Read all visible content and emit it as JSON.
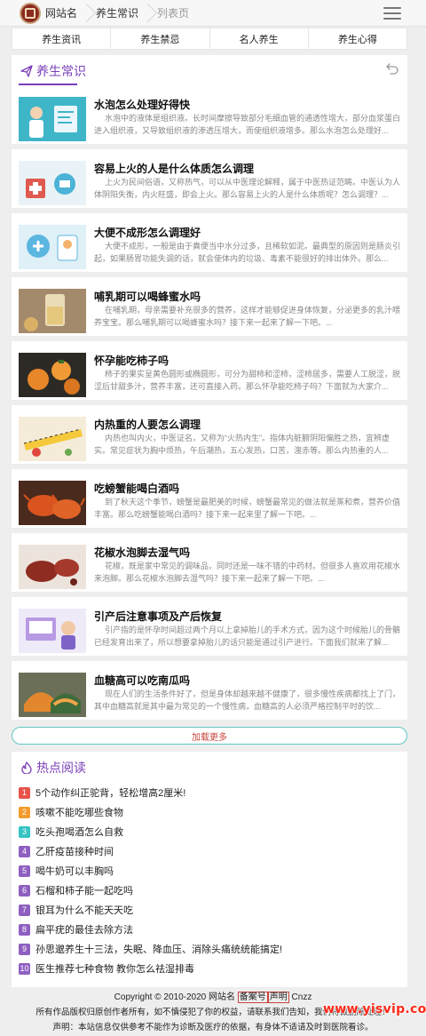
{
  "header": {
    "site_name": "网站名",
    "section": "养生常识",
    "page": "列表页"
  },
  "nav": [
    {
      "label": "养生资讯"
    },
    {
      "label": "养生禁忌"
    },
    {
      "label": "名人养生"
    },
    {
      "label": "养生心得"
    }
  ],
  "main": {
    "section_title": "养生常识",
    "articles": [
      {
        "title": "水泡怎么处理好得快",
        "desc": "水泡中的液体是组织液。长时间摩擦导致部分毛细血管的通透性增大，部分血浆蛋白进入组织液，又导致组织液的渗透压增大，而使组织液增多。那么水泡怎么处理好..."
      },
      {
        "title": "容易上火的人是什么体质怎么调理",
        "desc": "上火为民间俗语，又称热气，可以从中医理论解释，属于中医热证范畴。中医认为人体阴阳失衡，内火旺盛，即会上火。那么容易上火的人是什么体质呢？怎么调理？..."
      },
      {
        "title": "大便不成形怎么调理好",
        "desc": "大便不成形，一般是由于粪便当中水分过多，且稀软如泥。最典型的原因则是肠炎引起，如果肠胃功能失调的话，就会使体内的垃圾、毒素不能很好的排出体外。那么..."
      },
      {
        "title": "哺乳期可以喝蜂蜜水吗",
        "desc": "在哺乳期，母亲需要补充很多的营养，这样才能够促进身体恢复，分泌更多的乳汁喂养宝宝。那么哺乳期可以喝蜂蜜水吗？接下来一起来了解一下吧。..."
      },
      {
        "title": "怀孕能吃柿子吗",
        "desc": "柿子的果实呈黄色圆形或椭圆形，可分为甜柿和涩柿，涩柿居多，需要人工脱涩，脱涩后甘甜多汁，营养丰富，还可直接入药。那么怀孕能吃柿子吗？下面就为大家介..."
      },
      {
        "title": "内热重的人要怎么调理",
        "desc": "内热也叫内火，中医证名，又称为“火热内生”。指体内脏腑阴阳偏胜之热，宜辨虚实。常见症状为胸中烦热，午后潮热，五心发热，口苦，溲赤等。那么内热重的人..."
      },
      {
        "title": "吃螃蟹能喝白酒吗",
        "desc": "到了秋天这个季节，螃蟹是最肥美的时候，螃蟹最常见的做法就是蒸和煮，营养价值丰富。那么吃螃蟹能喝白酒吗？接下来一起来里了解一下吧。..."
      },
      {
        "title": "花椒水泡脚去湿气吗",
        "desc": "花椒，既是家中常见的调味品，同时还是一味不错的中药材。但很多人喜欢用花椒水来泡脚。那么花椒水泡脚去湿气吗？接下来一起来了解一下吧。..."
      },
      {
        "title": "引产后注意事项及产后恢复",
        "desc": "引产指的是怀孕时间超过两个月以上拿掉胎儿的手术方式，因为这个时候胎儿的骨骼已经发育出来了，所以想要拿掉胎儿的话只能是通过引产进行。下面我们就来了解..."
      },
      {
        "title": "血糖高可以吃南瓜吗",
        "desc": "现在人们的生活条件好了，但是身体却越来越不健康了，很多慢性疾病都找上了门，其中血糖高就是其中最为常见的一个慢性病，血糖高的人必须严格控制平时的饮..."
      }
    ],
    "load_more": "加载更多"
  },
  "hot": {
    "title": "热点阅读",
    "items": [
      {
        "num": "1",
        "label": "5个动作纠正驼背，轻松增高2厘米!",
        "color": "#e8534a"
      },
      {
        "num": "2",
        "label": "咳嗽不能吃哪些食物",
        "color": "#f39b2e"
      },
      {
        "num": "3",
        "label": "吃头孢喝酒怎么自救",
        "color": "#35c3c3"
      },
      {
        "num": "4",
        "label": "乙肝疫苗接种时间",
        "color": "#8e5fc1"
      },
      {
        "num": "5",
        "label": "喝牛奶可以丰胸吗",
        "color": "#8e5fc1"
      },
      {
        "num": "6",
        "label": "石榴和柿子能一起吃吗",
        "color": "#8e5fc1"
      },
      {
        "num": "7",
        "label": "银耳为什么不能天天吃",
        "color": "#8e5fc1"
      },
      {
        "num": "8",
        "label": "扁平疣的最佳去除方法",
        "color": "#8e5fc1"
      },
      {
        "num": "9",
        "label": "孙思邈养生十三法，失眠、降血压、消除头痛统统能搞定!",
        "color": "#8e5fc1"
      },
      {
        "num": "10",
        "label": "医生推荐七种食物 教你怎么祛湿排毒",
        "color": "#8e5fc1"
      }
    ]
  },
  "footer": {
    "copyright": "Copyright © 2010-2020 网站名",
    "beian": "备案号",
    "statement": "声明",
    "cnzz": "Cnzz",
    "line2": "所有作品版权归原创作者所有，如不慎侵犯了你的权益，请联系我们告知，我们将做删除处理！",
    "line3": "声明：本站信息仅供参考不能作为诊断及医疗的依据，有身体不适请及时到医院看诊。"
  },
  "watermark": "www.yisvip.com",
  "colors": {
    "accent": "#7b3fb8",
    "link": "#c8433b",
    "border": "#5fc7c1"
  }
}
